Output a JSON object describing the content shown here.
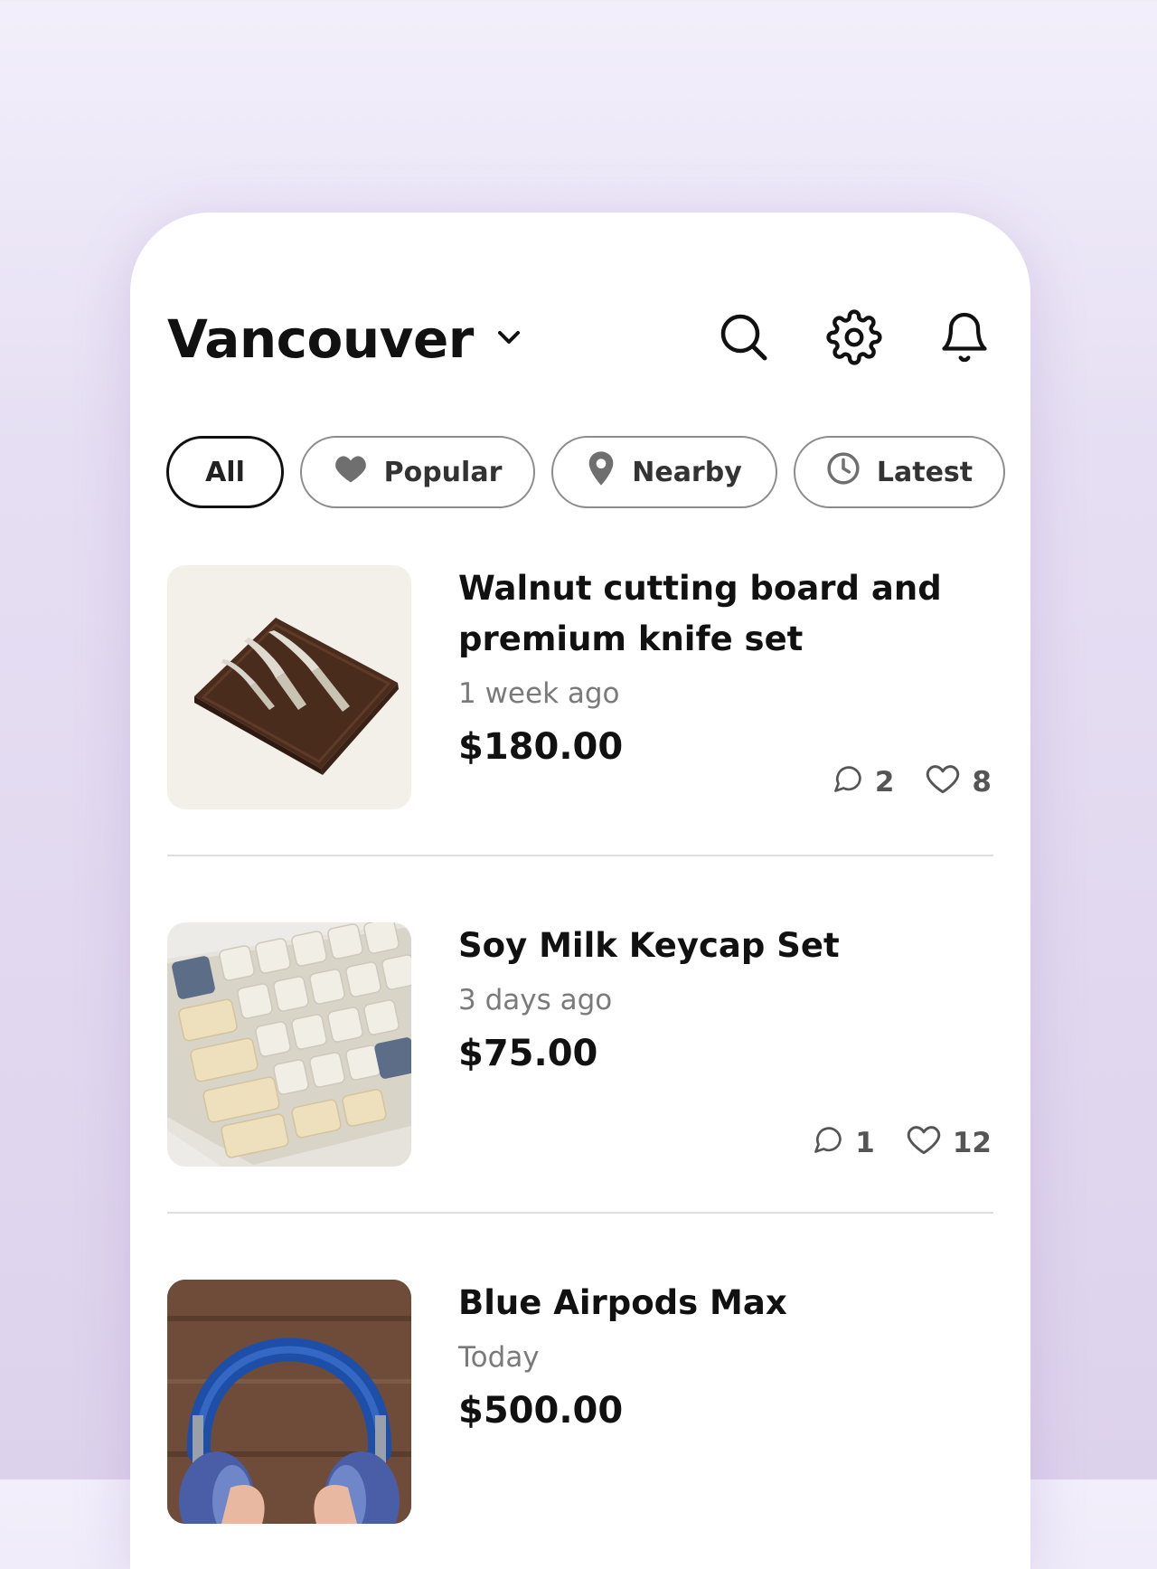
{
  "header": {
    "city": "Vancouver"
  },
  "filters": [
    {
      "label": "All"
    },
    {
      "label": "Popular"
    },
    {
      "label": "Nearby"
    },
    {
      "label": "Latest"
    }
  ],
  "listings": [
    {
      "title": "Walnut cutting board and premium knife set",
      "time": "1 week ago",
      "price": "$180.00",
      "comments": "2",
      "likes": "8"
    },
    {
      "title": "Soy Milk Keycap Set",
      "time": "3 days ago",
      "price": "$75.00",
      "comments": "1",
      "likes": "12"
    },
    {
      "title": "Blue Airpods Max",
      "time": "Today",
      "price": "$500.00"
    }
  ],
  "colors": {
    "background": "#e6dff3",
    "card": "#ffffff",
    "text": "#111111",
    "muted": "#7a7a7a"
  },
  "icons": [
    "chevron-down-icon",
    "search-icon",
    "gear-icon",
    "bell-icon",
    "heart-icon",
    "location-pin-icon",
    "clock-icon",
    "comment-icon"
  ]
}
